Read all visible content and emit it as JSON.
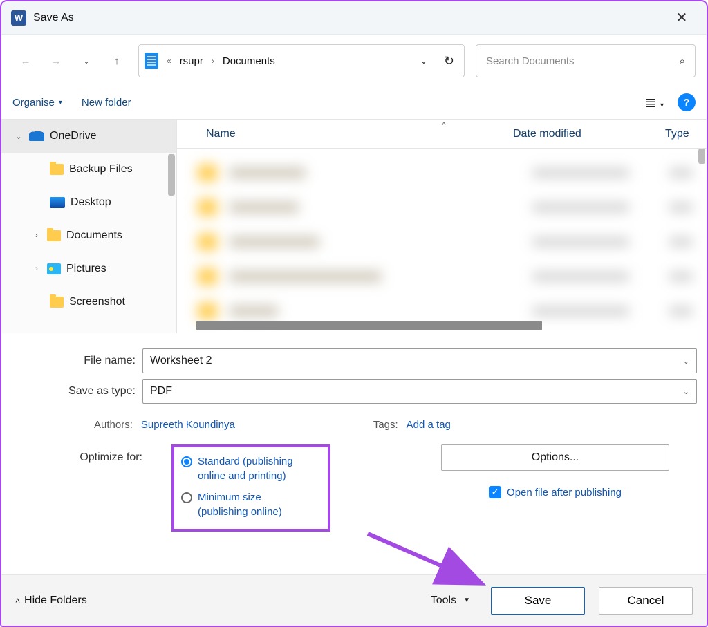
{
  "title": "Save As",
  "breadcrumb": {
    "parent": "rsupr",
    "current": "Documents"
  },
  "search": {
    "placeholder": "Search Documents"
  },
  "toolbar": {
    "organise": "Organise",
    "new_folder": "New folder"
  },
  "tree": {
    "onedrive": "OneDrive",
    "backup": "Backup Files",
    "desktop": "Desktop",
    "documents": "Documents",
    "pictures": "Pictures",
    "screenshot": "Screenshot"
  },
  "columns": {
    "name": "Name",
    "date": "Date modified",
    "type": "Type"
  },
  "form": {
    "file_name_label": "File name:",
    "file_name_value": "Worksheet 2",
    "save_type_label": "Save as type:",
    "save_type_value": "PDF",
    "authors_label": "Authors:",
    "authors_value": "Supreeth Koundinya",
    "tags_label": "Tags:",
    "tags_value": "Add a tag",
    "optimize_label": "Optimize for:",
    "opt_standard": "Standard (publishing online and printing)",
    "opt_minimum": "Minimum size (publishing online)",
    "options_btn": "Options...",
    "open_after": "Open file after publishing"
  },
  "footer": {
    "hide_folders": "Hide Folders",
    "tools": "Tools",
    "save": "Save",
    "cancel": "Cancel"
  },
  "colors": {
    "accent": "#0a84ff",
    "highlight": "#a24ae2",
    "link": "#1157b8"
  }
}
